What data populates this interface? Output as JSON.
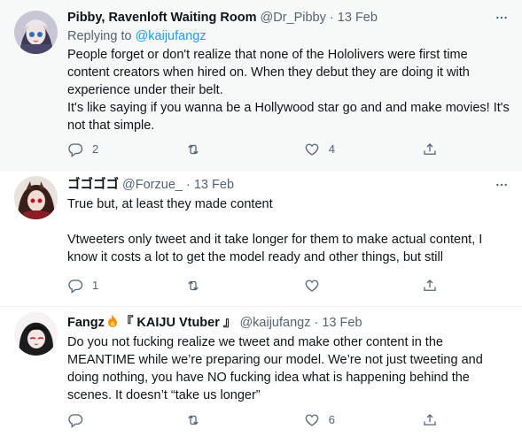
{
  "tweets": [
    {
      "name": "Pibby, Ravenloft Waiting Room",
      "handle": "@Dr_Pibby",
      "dot": "·",
      "date": "13 Feb",
      "replying_prefix": "Replying to ",
      "replying_to": "@kaijufangz",
      "text": "People forget or don't realize that none of the Hololivers were first time content creators when hired on. When they debut they are doing it with experience under their belt.\nIt's like saying if you wanna be a Hollywood star go and and make movies! It's not that simple.",
      "replies": "2",
      "retweets": "",
      "likes": "4"
    },
    {
      "name": "ゴゴゴゴ",
      "handle": "@Forzue_",
      "dot": "·",
      "date": "13 Feb",
      "text": "True but, at least they made content\n\nVtweeters only tweet and it take longer for them to make actual content, I know it costs a lot to get the model ready and other things, but still",
      "replies": "1",
      "retweets": "",
      "likes": ""
    },
    {
      "name_prefix": "Fangz",
      "name_suffix": "『 KAIJU Vtuber 』",
      "handle": "@kaijufangz",
      "dot": "·",
      "date": "13 Feb",
      "text": "Do you not fucking realize we tweet and make other content in the MEANTIME while we’re preparing our model. We’re not just tweeting and doing nothing, you have NO fucking idea what is happening behind the scenes. It doesn’t “take us longer”",
      "replies": "",
      "retweets": "",
      "likes": "6"
    }
  ],
  "icons": {
    "reply": "reply-icon",
    "retweet": "retweet-icon",
    "like": "like-icon",
    "share": "share-icon",
    "more": "more-icon",
    "fire": "fire-emoji-icon"
  }
}
